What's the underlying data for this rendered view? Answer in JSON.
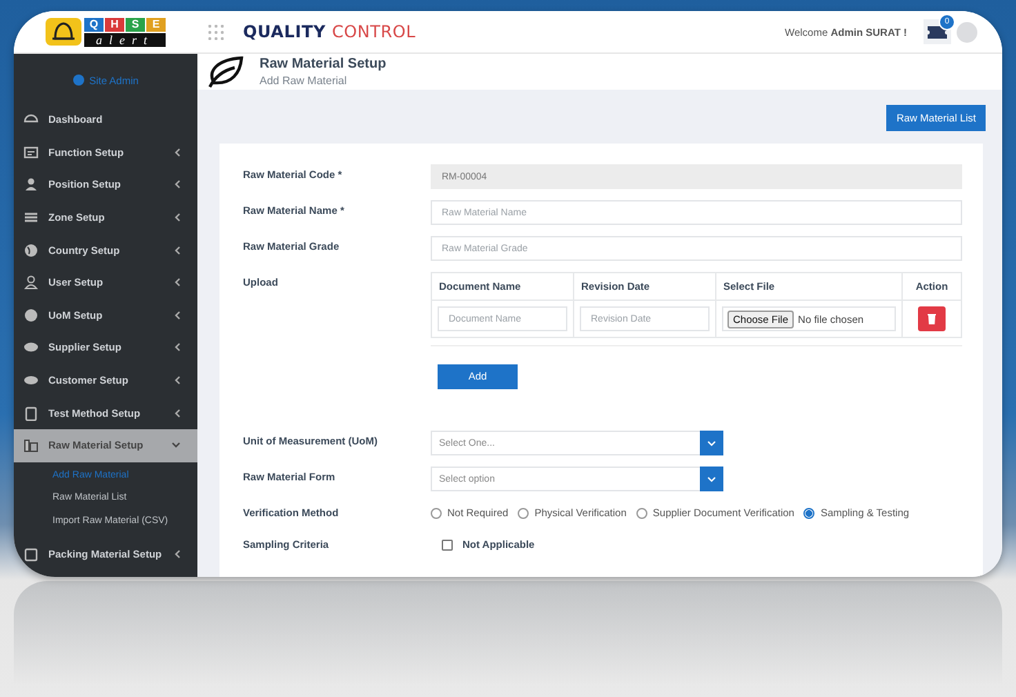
{
  "logo": {
    "letters": [
      "Q",
      "H",
      "S",
      "E"
    ],
    "bottom": "alert"
  },
  "brand": {
    "primary": "QUALITY",
    "secondary": "CONTROL"
  },
  "welcome": "Welcome **Admin SURAT !**",
  "notifications": {
    "count": "0"
  },
  "sidebar": {
    "user": "Site Admin",
    "items": [
      {
        "label": "Dashboard",
        "selected": false
      },
      {
        "label": "Function Setup",
        "expanded": false,
        "selected": false
      },
      {
        "label": "Position Setup",
        "expanded": false,
        "selected": false
      },
      {
        "label": "Zone Setup",
        "expanded": false,
        "selected": false
      },
      {
        "label": "Country Setup",
        "expanded": false,
        "selected": false
      },
      {
        "label": "User Setup",
        "expanded": false,
        "selected": false
      },
      {
        "label": "UoM Setup",
        "expanded": false,
        "selected": false
      },
      {
        "label": "Supplier Setup",
        "expanded": false,
        "selected": false
      },
      {
        "label": "Customer Setup",
        "expanded": false,
        "selected": false
      },
      {
        "label": "Test Method Setup",
        "expanded": false,
        "selected": false
      },
      {
        "label": "Raw Material Setup",
        "expanded": true,
        "selected": true,
        "children": [
          {
            "label": "Add Raw Material",
            "selected": true
          },
          {
            "label": "Raw Material List",
            "selected": false
          },
          {
            "label": "Import Raw Material (CSV)",
            "selected": false
          }
        ]
      },
      {
        "label": "Packing Material Setup",
        "expanded": false,
        "selected": false
      }
    ]
  },
  "page_header": {
    "title": "Raw Material Setup",
    "subtitle": "Add Raw Material"
  },
  "list_button": "Raw Material List",
  "fields": [
    {
      "kind": "text",
      "label": "Raw Material Code *",
      "value": "RM-00004",
      "disabled": true
    },
    {
      "kind": "text",
      "label": "Raw Material Name *",
      "placeholder": "Raw Material Name",
      "disabled": false
    },
    {
      "kind": "text",
      "label": "Raw Material Grade",
      "placeholder": "Raw Material Grade",
      "disabled": false
    },
    {
      "kind": "upload",
      "label": "Upload",
      "columns": [
        "Document Name",
        "Revision Date",
        "Select File",
        "Action"
      ],
      "rows": [
        {
          "document_placeholder": "Document Name",
          "date_placeholder": "Revision Date",
          "file_button": "Choose File",
          "file_status": "No file chosen"
        }
      ],
      "add_button": "Add"
    },
    {
      "kind": "select",
      "label": "Unit of Measurement (UoM)",
      "placeholder": "Select One..."
    },
    {
      "kind": "select",
      "label": "Raw Material Form",
      "placeholder": "Select option"
    },
    {
      "kind": "radio",
      "label": "Verification Method",
      "options": [
        {
          "label": "Not Required",
          "selected": false
        },
        {
          "label": "Physical Verification",
          "selected": false
        },
        {
          "label": "Supplier Document Verification",
          "selected": false
        },
        {
          "label": "Sampling & Testing",
          "selected": true
        }
      ]
    },
    {
      "kind": "checkbox",
      "label": "Sampling Criteria",
      "option": "Not Applicable",
      "checked": false
    }
  ]
}
